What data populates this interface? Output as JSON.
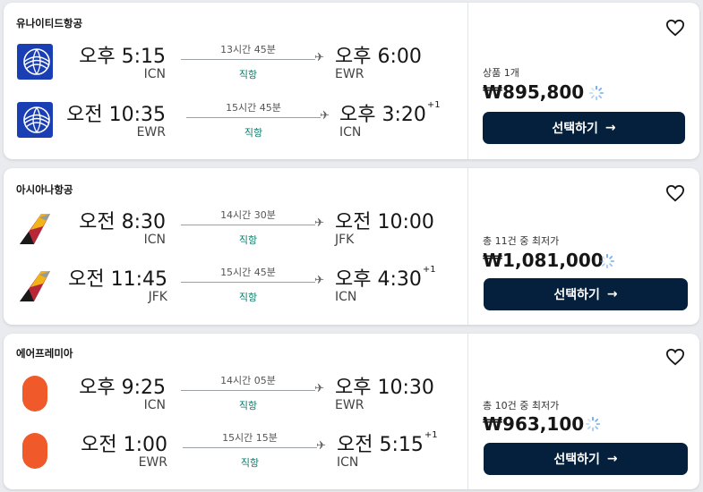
{
  "results": [
    {
      "airline": "유나이티드항공",
      "logo": "united-logo",
      "legs": [
        {
          "dep_time": "오후 5:15",
          "dep_code": "ICN",
          "duration": "13시간 45분",
          "stops": "직항",
          "arr_time": "오후 6:00",
          "arr_plus": "",
          "arr_code": "EWR"
        },
        {
          "dep_time": "오전 10:35",
          "dep_code": "EWR",
          "duration": "15시간 45분",
          "stops": "직항",
          "arr_time": "오후 3:20",
          "arr_plus": "+1",
          "arr_code": "ICN"
        }
      ],
      "price_label": "상품 1개",
      "price": "₩895,800",
      "button": "선택하기"
    },
    {
      "airline": "아시아나항공",
      "logo": "asiana-logo",
      "legs": [
        {
          "dep_time": "오전 8:30",
          "dep_code": "ICN",
          "duration": "14시간 30분",
          "stops": "직항",
          "arr_time": "오전 10:00",
          "arr_plus": "",
          "arr_code": "JFK"
        },
        {
          "dep_time": "오전 11:45",
          "dep_code": "JFK",
          "duration": "15시간 45분",
          "stops": "직항",
          "arr_time": "오후 4:30",
          "arr_plus": "+1",
          "arr_code": "ICN"
        }
      ],
      "price_label": "총 11건 중 최저가",
      "price": "₩1,081,000",
      "button": "선택하기"
    },
    {
      "airline": "에어프레미아",
      "logo": "airpremia-logo",
      "legs": [
        {
          "dep_time": "오후 9:25",
          "dep_code": "ICN",
          "duration": "14시간 05분",
          "stops": "직항",
          "arr_time": "오후 10:30",
          "arr_plus": "",
          "arr_code": "EWR"
        },
        {
          "dep_time": "오전 1:00",
          "dep_code": "EWR",
          "duration": "15시간 15분",
          "stops": "직항",
          "arr_time": "오전 5:15",
          "arr_plus": "+1",
          "arr_code": "ICN"
        }
      ],
      "price_label": "총 10건 중 최저가",
      "price": "₩963,100",
      "button": "선택하기"
    }
  ],
  "colors": {
    "button_bg": "#05203c",
    "stops_text": "#0a7a6a",
    "united_blue": "#1a3fb5",
    "airpremia_orange": "#f0592a"
  },
  "icons": {
    "favorite": "heart-outline-icon",
    "plane": "plane-icon",
    "loading": "spinner-icon",
    "arrow": "arrow-right-icon"
  }
}
